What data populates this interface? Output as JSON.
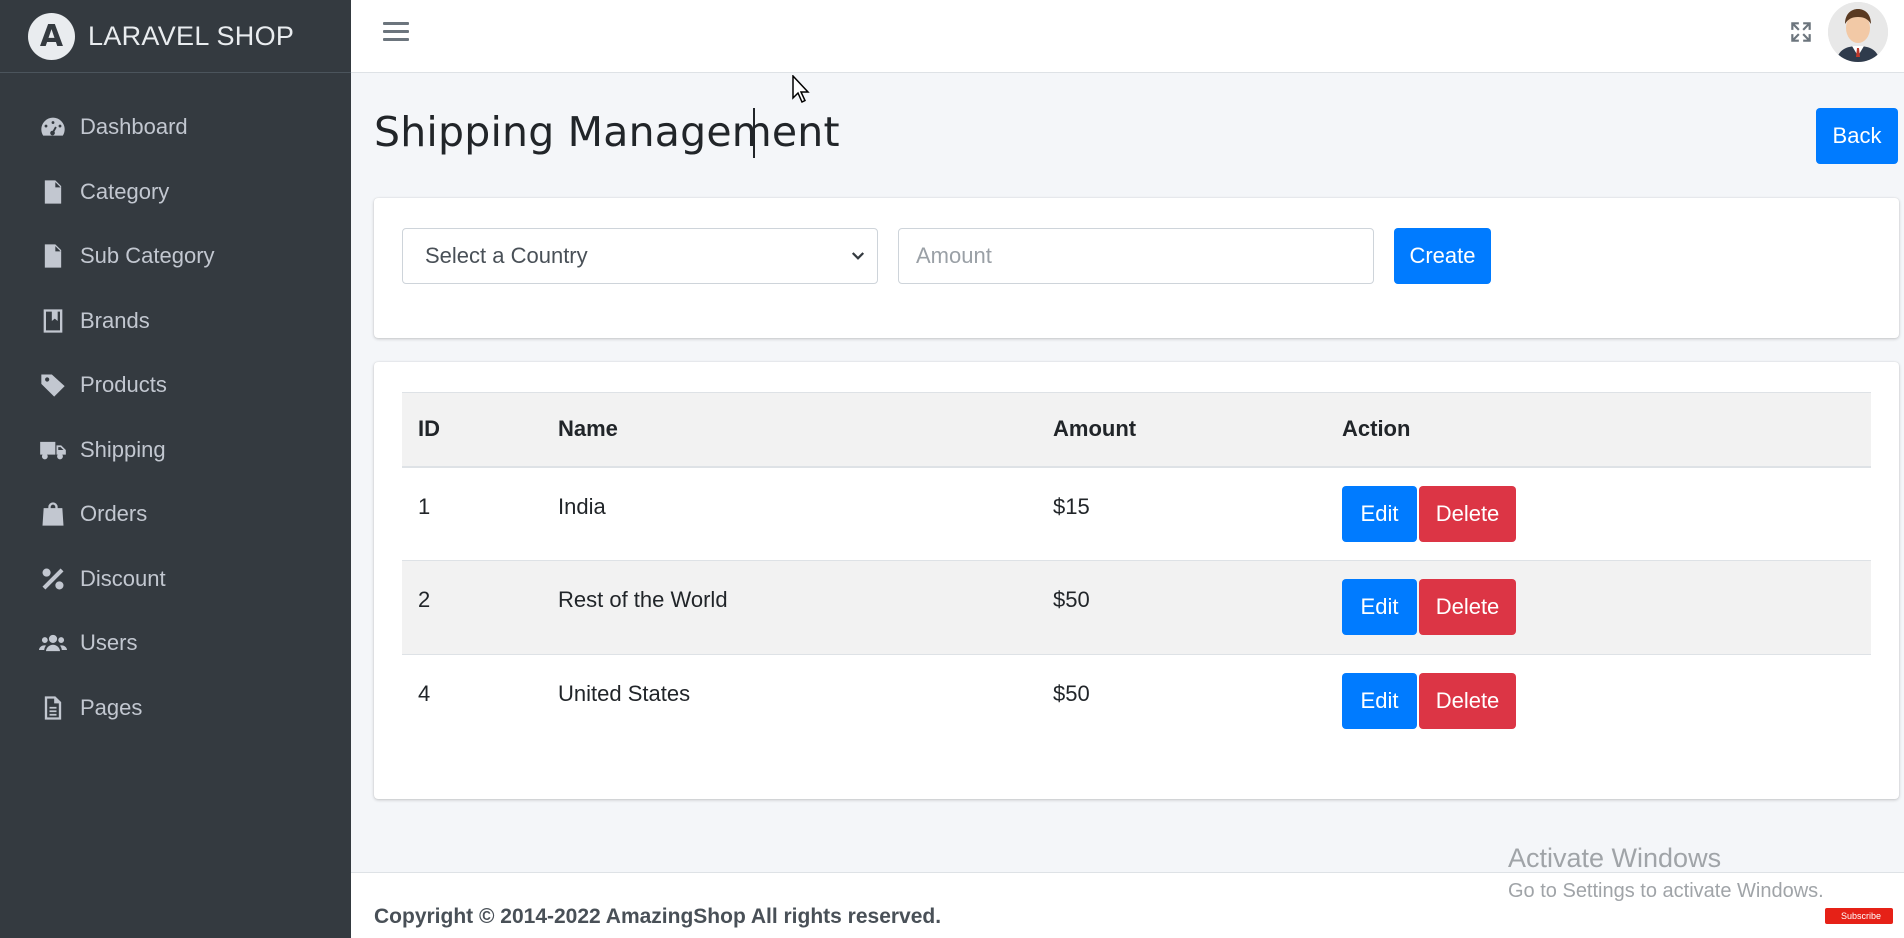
{
  "brand": {
    "name": "LARAVEL SHOP",
    "logo_letter": "A"
  },
  "sidebar": {
    "items": [
      {
        "label": "Dashboard",
        "icon": "dashboard-gauge-icon"
      },
      {
        "label": "Category",
        "icon": "file-icon"
      },
      {
        "label": "Sub Category",
        "icon": "file-icon"
      },
      {
        "label": "Brands",
        "icon": "bookmark-icon"
      },
      {
        "label": "Products",
        "icon": "tag-icon"
      },
      {
        "label": "Shipping",
        "icon": "truck-icon"
      },
      {
        "label": "Orders",
        "icon": "shopping-bag-icon"
      },
      {
        "label": "Discount",
        "icon": "percent-icon"
      },
      {
        "label": "Users",
        "icon": "users-icon"
      },
      {
        "label": "Pages",
        "icon": "file-alt-icon"
      }
    ]
  },
  "header": {
    "title": "Shipping Management",
    "back_label": "Back"
  },
  "form": {
    "country_select": {
      "selected": "Select a Country"
    },
    "amount_placeholder": "Amount",
    "create_label": "Create"
  },
  "table": {
    "columns": [
      "ID",
      "Name",
      "Amount",
      "Action"
    ],
    "rows": [
      {
        "id": "1",
        "name": "India",
        "amount": "$15",
        "edit": "Edit",
        "delete": "Delete"
      },
      {
        "id": "2",
        "name": "Rest of the World",
        "amount": "$50",
        "edit": "Edit",
        "delete": "Delete"
      },
      {
        "id": "4",
        "name": "United States",
        "amount": "$50",
        "edit": "Edit",
        "delete": "Delete"
      }
    ]
  },
  "footer": {
    "text": "Copyright © 2014-2022 AmazingShop All rights reserved."
  },
  "watermark": {
    "line1": "Activate Windows",
    "line2": "Go to Settings to activate Windows."
  },
  "yt_badge": "Subscribe",
  "colors": {
    "sidebar": "#343a40",
    "primary": "#007bff",
    "danger": "#dc3545",
    "background": "#f4f6f9"
  }
}
